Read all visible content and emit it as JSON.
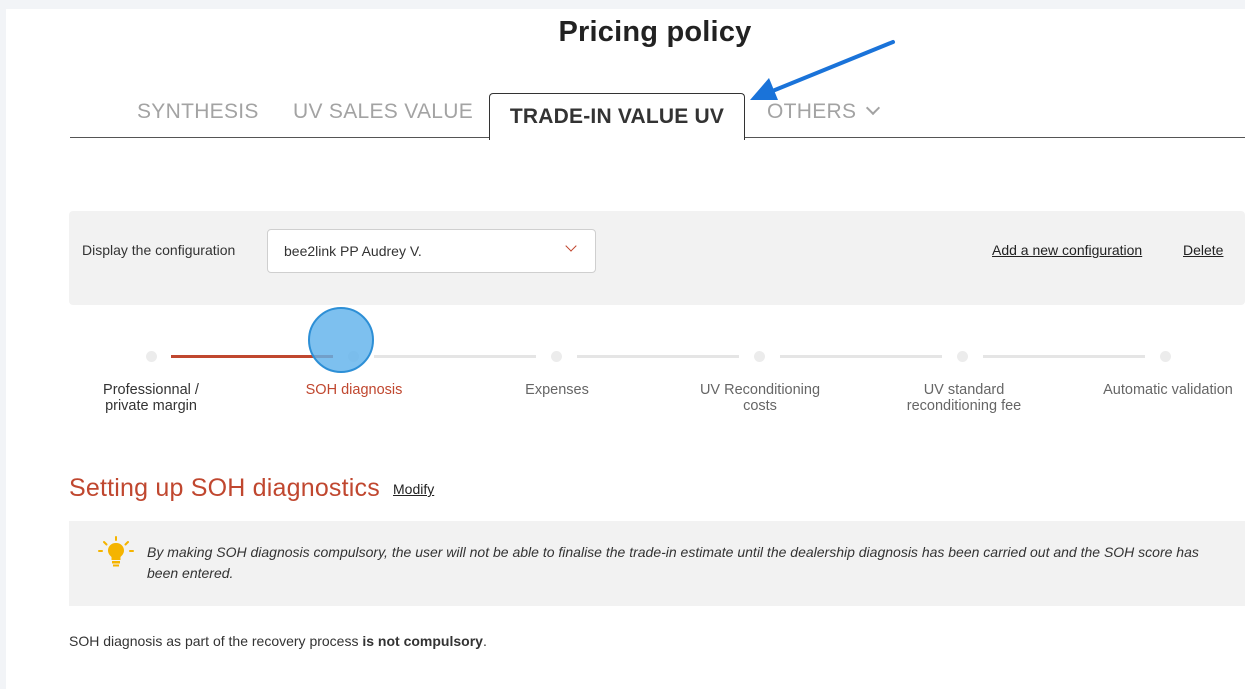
{
  "page": {
    "title": "Pricing policy"
  },
  "tabs": [
    {
      "label": "SYNTHESIS",
      "active": false
    },
    {
      "label": "UV SALES VALUE",
      "active": false
    },
    {
      "label": "TRADE-IN VALUE UV",
      "active": true
    },
    {
      "label": "OTHERS",
      "active": false,
      "has_dropdown": true
    }
  ],
  "config": {
    "label": "Display the configuration",
    "selected": "bee2link PP Audrey V.",
    "add_link": "Add a new configuration",
    "delete_link": "Delete"
  },
  "steps": [
    {
      "label": "Professionnal / private margin",
      "status": "completed"
    },
    {
      "label": "SOH diagnosis",
      "status": "current"
    },
    {
      "label": "Expenses",
      "status": "pending"
    },
    {
      "label": "UV Reconditioning costs",
      "status": "pending"
    },
    {
      "label": "UV standard reconditioning fee",
      "status": "pending"
    },
    {
      "label": "Automatic validation",
      "status": "pending"
    }
  ],
  "section": {
    "title": "Setting up SOH diagnostics",
    "modify_link": "Modify",
    "info": "By making SOH diagnosis compulsory, the user will not be able to finalise the trade-in estimate until the dealership diagnosis has been carried out and the SOH score has been entered.",
    "status_prefix": "SOH diagnosis as part of the recovery process ",
    "status_value": "is not compulsory",
    "status_suffix": "."
  },
  "colors": {
    "accent": "#c0472f",
    "annotation_arrow": "#1a73d9",
    "panel_bg": "#f2f2f2"
  },
  "icons": {
    "info": "lightbulb-icon",
    "dropdown": "chevron-down-icon"
  }
}
